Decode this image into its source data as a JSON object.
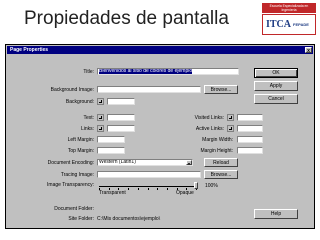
{
  "slide": {
    "title": "Propiedades de pantalla",
    "logo": {
      "top_text": "Escuela Especializada en Ingeniería",
      "itca": "ITCA",
      "fepade": "FEPADE"
    }
  },
  "dialog": {
    "title": "Page Properties",
    "close_glyph": "x",
    "fields": {
      "title_label": "Title:",
      "title_value": "Bienvenidos al sitio de colores de ejemplo",
      "bg_image_label": "Background Image:",
      "background_label": "Background:",
      "text_label": "Text:",
      "links_label": "Links:",
      "visited_links_label": "Visited Links:",
      "active_links_label": "Active Links:",
      "left_margin_label": "Left Margin:",
      "margin_width_label": "Margin Width:",
      "top_margin_label": "Top Margin:",
      "margin_height_label": "Margin Height:",
      "encoding_label": "Document Encoding:",
      "encoding_value": "Western (Latin1)",
      "tracing_image_label": "Tracing Image:",
      "image_transparency_label": "Image Transparency:",
      "transparency_value": "100%",
      "transparency_level": 1.0,
      "transparent_label": "Transparent",
      "opaque_label": "Opaque",
      "document_folder_label": "Document Folder:",
      "site_folder_label": "Site Folder:",
      "site_folder_value": "C:\\Mis documentos\\ejemplo\\"
    },
    "buttons": {
      "ok": "OK",
      "apply": "Apply",
      "cancel": "Cancel",
      "browse": "Browse...",
      "reload": "Reload",
      "help": "Help"
    }
  }
}
